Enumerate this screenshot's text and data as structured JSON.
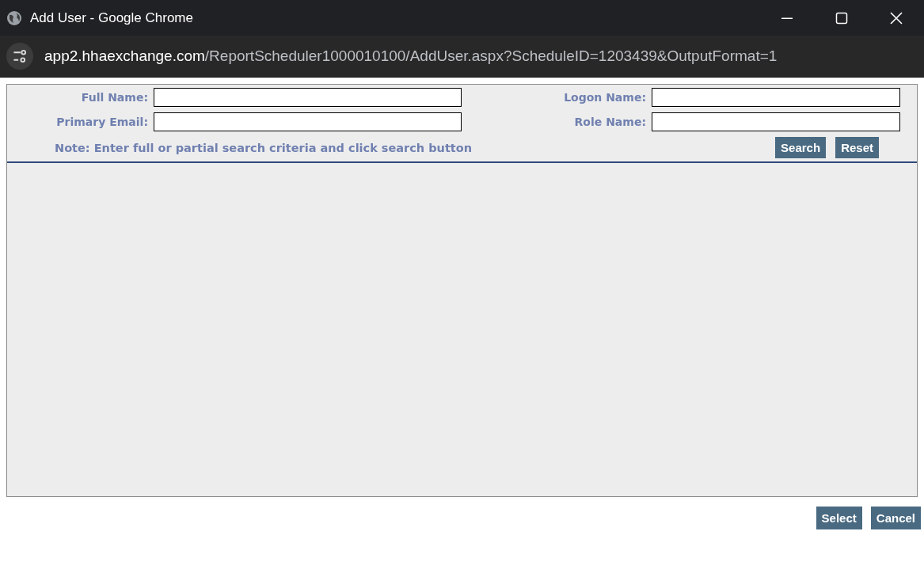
{
  "window": {
    "title": "Add User - Google Chrome"
  },
  "address_bar": {
    "host": "app2.hhaexchange.com",
    "path": "/ReportScheduler1000010100/AddUser.aspx?ScheduleID=1203439&OutputFormat=1"
  },
  "search_form": {
    "fields": [
      {
        "label": "Full Name:"
      },
      {
        "label": "Logon Name:"
      },
      {
        "label": "Primary Email:"
      },
      {
        "label": "Role Name:"
      }
    ],
    "note": "Note: Enter full or partial search criteria and click search button",
    "buttons": [
      "Search",
      "Reset"
    ]
  },
  "footer_buttons": [
    "Select",
    "Cancel"
  ]
}
